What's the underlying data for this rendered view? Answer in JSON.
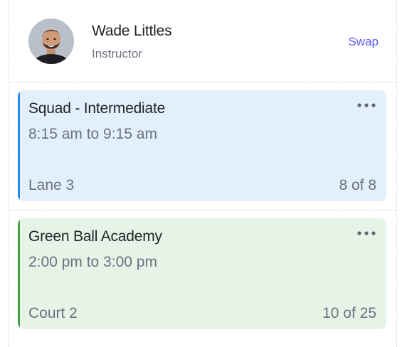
{
  "colors": {
    "accent_link": "#5b5cf0",
    "card_blue_bg": "#e3f0fc",
    "card_blue_accent": "#1e88e5",
    "card_green_bg": "#e6f4e7",
    "card_green_accent": "#43a047"
  },
  "instructor": {
    "name": "Wade Littles",
    "role": "Instructor",
    "swap_label": "Swap"
  },
  "sessions": [
    {
      "title": "Squad - Intermediate",
      "time": "8:15 am to 9:15 am",
      "location": "Lane 3",
      "capacity": "8 of 8",
      "color": "blue",
      "menu_icon": "more-horizontal-icon"
    },
    {
      "title": "Green Ball Academy",
      "time": "2:00 pm to 3:00 pm",
      "location": "Court 2",
      "capacity": "10 of 25",
      "color": "green",
      "menu_icon": "more-horizontal-icon"
    }
  ]
}
